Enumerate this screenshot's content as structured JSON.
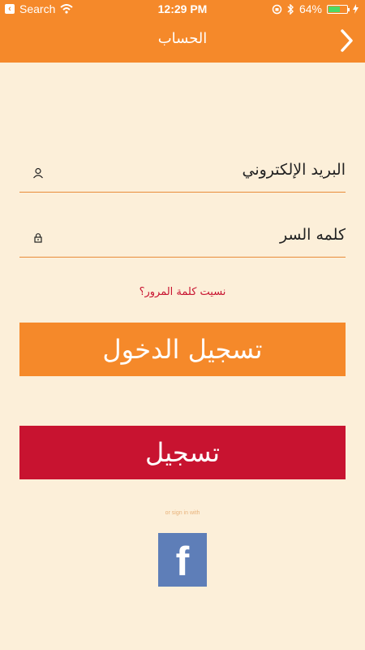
{
  "status_bar": {
    "back_app": "Search",
    "time": "12:29 PM",
    "battery": "64%",
    "battery_level": 0.64
  },
  "nav": {
    "title": "الحساب"
  },
  "form": {
    "email_label": "البريد الإلكتروني",
    "password_label": "كلمه السر",
    "forgot_password": "نسيت كلمة المرور؟",
    "login_button": "تسجيل الدخول",
    "register_button": "تسجيل",
    "or_sign_in_with": "or sign in with",
    "facebook": "f"
  },
  "colors": {
    "accent": "#f5892a",
    "danger": "#c81330",
    "background": "#fcefd9",
    "facebook": "#5e7eb8"
  }
}
